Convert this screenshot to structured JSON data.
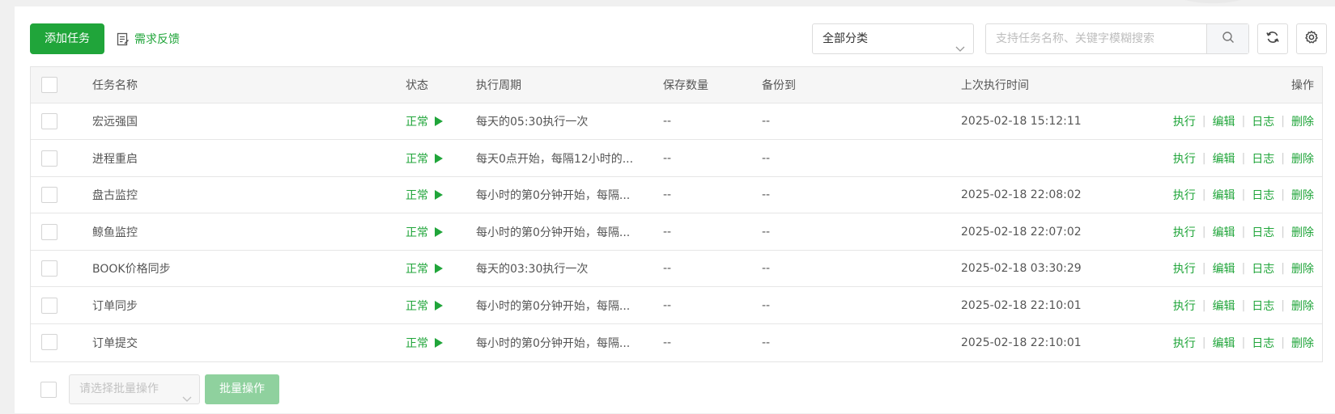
{
  "toolbar": {
    "add_task_label": "添加任务",
    "feedback_label": "需求反馈",
    "category_select_value": "全部分类",
    "search_placeholder": "支持任务名称、关键字模糊搜索"
  },
  "table": {
    "headers": {
      "name": "任务名称",
      "status": "状态",
      "cycle": "执行周期",
      "count": "保存数量",
      "backup": "备份到",
      "last_run": "上次执行时间",
      "ops": "操作"
    },
    "rows": [
      {
        "name": "宏远强国",
        "status": "正常",
        "cycle": "每天的05:30执行一次",
        "count": "--",
        "backup": "--",
        "last_run": "2025-02-18 15:12:11"
      },
      {
        "name": "进程重启",
        "status": "正常",
        "cycle": "每天0点开始，每隔12小时的...",
        "count": "--",
        "backup": "--",
        "last_run": ""
      },
      {
        "name": "盘古监控",
        "status": "正常",
        "cycle": "每小时的第0分钟开始，每隔...",
        "count": "--",
        "backup": "--",
        "last_run": "2025-02-18 22:08:02"
      },
      {
        "name": "鲸鱼监控",
        "status": "正常",
        "cycle": "每小时的第0分钟开始，每隔...",
        "count": "--",
        "backup": "--",
        "last_run": "2025-02-18 22:07:02"
      },
      {
        "name": "BOOK价格同步",
        "status": "正常",
        "cycle": "每天的03:30执行一次",
        "count": "--",
        "backup": "--",
        "last_run": "2025-02-18 03:30:29"
      },
      {
        "name": "订单同步",
        "status": "正常",
        "cycle": "每小时的第0分钟开始，每隔...",
        "count": "--",
        "backup": "--",
        "last_run": "2025-02-18 22:10:01"
      },
      {
        "name": "订单提交",
        "status": "正常",
        "cycle": "每小时的第0分钟开始，每隔...",
        "count": "--",
        "backup": "--",
        "last_run": "2025-02-18 22:10:01"
      }
    ],
    "row_actions": {
      "run": "执行",
      "edit": "编辑",
      "log": "日志",
      "delete": "删除",
      "separator": "|"
    }
  },
  "footer": {
    "batch_select_placeholder": "请选择批量操作",
    "batch_button_label": "批量操作"
  },
  "colors": {
    "accent": "#20a53a",
    "accent_disabled": "#8fd19e"
  }
}
